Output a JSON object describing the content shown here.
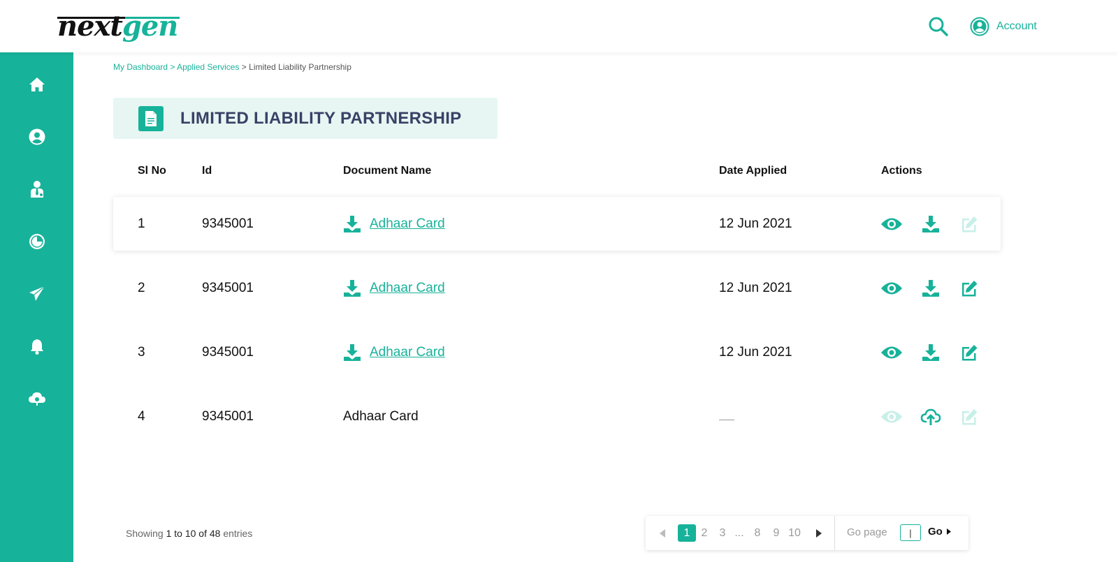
{
  "header": {
    "logo_part1": "next",
    "logo_part2": "gen",
    "account_label": "Account"
  },
  "sidebar": {
    "items": [
      {
        "name": "home",
        "icon": "home-icon"
      },
      {
        "name": "profile",
        "icon": "user-circle-icon"
      },
      {
        "name": "agent",
        "icon": "person-tie-icon"
      },
      {
        "name": "reports",
        "icon": "pie-chart-icon"
      },
      {
        "name": "send",
        "icon": "paper-plane-icon"
      },
      {
        "name": "notifications",
        "icon": "bell-icon"
      },
      {
        "name": "cloud",
        "icon": "cloud-icon"
      }
    ]
  },
  "breadcrumb": {
    "item1": "My Dashboard",
    "sep1": " > ",
    "item2": "Applied Services",
    "sep2": " > ",
    "current": "Limited Liability Partnership"
  },
  "page_title": "LIMITED LIABILITY PARTNERSHIP",
  "table": {
    "headers": {
      "sl": "Sl No",
      "id": "Id",
      "doc": "Document Name",
      "date": "Date Applied",
      "actions": "Actions"
    },
    "rows": [
      {
        "sl": "1",
        "id": "9345001",
        "doc": "Adhaar Card",
        "date": "12 Jun 2021"
      },
      {
        "sl": "2",
        "id": "9345001",
        "doc": "Adhaar Card",
        "date": "12 Jun 2021"
      },
      {
        "sl": "3",
        "id": "9345001",
        "doc": "Adhaar Card",
        "date": "12 Jun 2021"
      },
      {
        "sl": "4",
        "id": "9345001",
        "doc": "Adhaar Card",
        "date": ""
      }
    ]
  },
  "footer": {
    "showing_prefix": "Showing ",
    "showing_range": "1 to 10 of 48",
    "showing_suffix": " entries",
    "pages": [
      "1",
      "2",
      "3",
      "...",
      "8",
      "9",
      "10"
    ],
    "current_page": "1",
    "go_page_label": "Go page",
    "go_page_value": "|",
    "go_label": "Go"
  },
  "colors": {
    "accent": "#17b29a",
    "accent_light": "#c8efe8",
    "title_bg": "#e7f6f3",
    "title_text": "#3a4166"
  }
}
